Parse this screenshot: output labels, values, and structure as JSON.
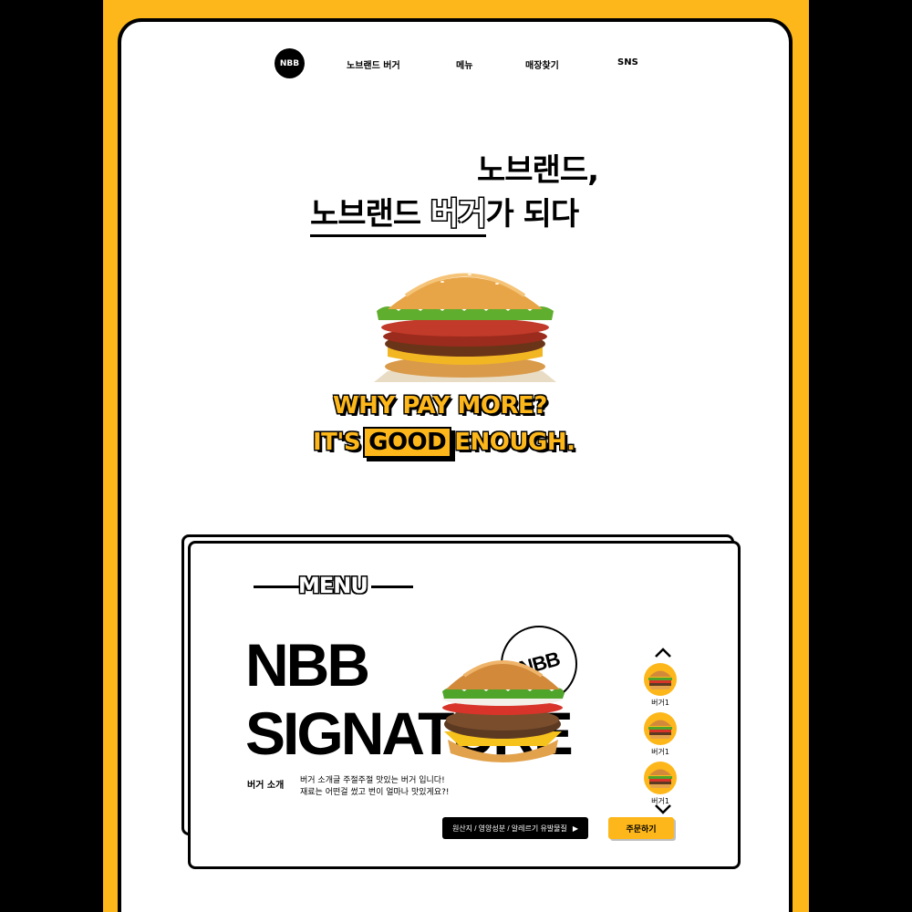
{
  "colors": {
    "brand_yellow": "#FDB71A",
    "ink": "#000000",
    "background": "#FFFFFF"
  },
  "nav": {
    "logo": "NBB",
    "links": [
      "노브랜드 버거",
      "메뉴",
      "매장찾기",
      "SNS"
    ]
  },
  "hero": {
    "line1": "노브랜드,",
    "line2_part1": "노브랜드",
    "line2_part2": "버거",
    "line2_part3": "가 되다"
  },
  "slogan": {
    "line1": "WHY PAY MORE?",
    "line2_prefix": "IT'S",
    "line2_box": "GOOD",
    "line2_suffix": "ENOUGH."
  },
  "menu": {
    "section_title": "MENU",
    "signature_line1": "NBB",
    "signature_line2": "SIGNATURE",
    "stamp_text": "NBB",
    "intro_label": "버거 소개",
    "intro_line1": "버거 소개글 주절주절 맛있는 버거 입니다!",
    "intro_line2": "재료는 어떤걸 썼고 번이 얼마나 맛있게요?!",
    "info_button": "원산지 / 영양성분 / 알레르기 유발물질",
    "info_button_arrow": "▶",
    "order_button": "주문하기",
    "thumbnails": [
      {
        "label": "버거1",
        "icon": "burger-icon"
      },
      {
        "label": "버거1",
        "icon": "burger-icon"
      },
      {
        "label": "버거1",
        "icon": "burger-icon"
      }
    ],
    "up_icon": "chevron-up-icon",
    "down_icon": "chevron-down-icon"
  }
}
